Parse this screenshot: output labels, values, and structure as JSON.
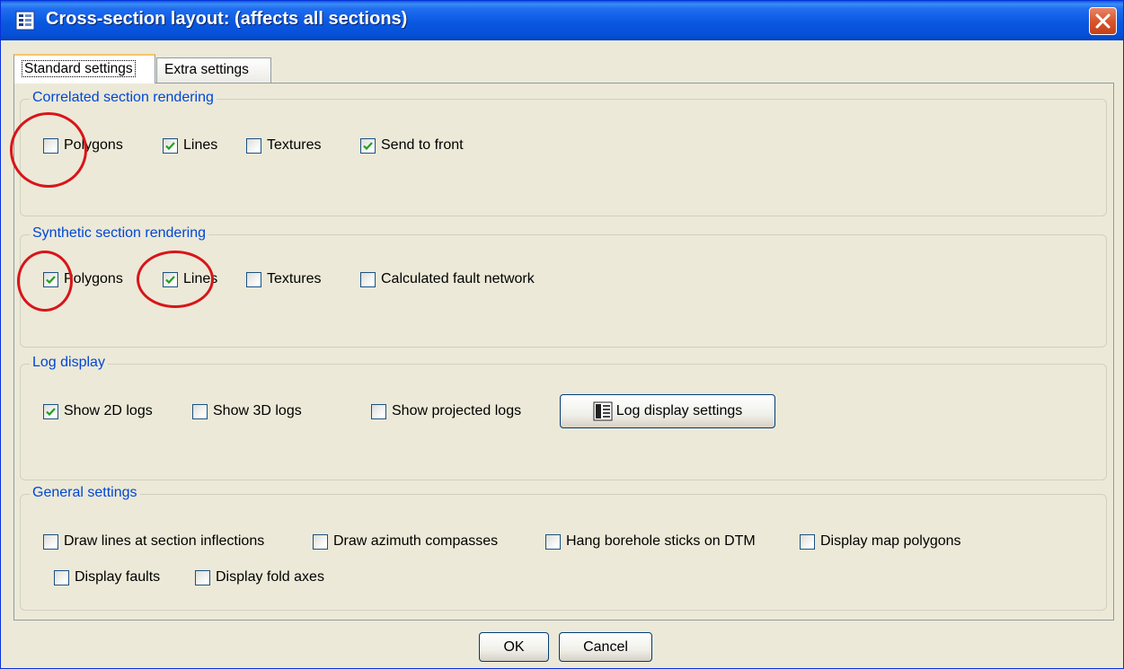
{
  "window": {
    "title": "Cross-section layout: (affects all sections)",
    "icon": "dialog-list-icon",
    "close_icon": "close-icon"
  },
  "tabs": [
    {
      "label": "Standard settings",
      "active": true
    },
    {
      "label": "Extra settings",
      "active": false
    }
  ],
  "correlated": {
    "legend": "Correlated section rendering",
    "options": [
      {
        "label": "Polygons",
        "checked": false
      },
      {
        "label": "Lines",
        "checked": true
      },
      {
        "label": "Textures",
        "checked": false
      },
      {
        "label": "Send to front",
        "checked": true
      }
    ]
  },
  "synthetic": {
    "legend": "Synthetic section rendering",
    "options": [
      {
        "label": "Polygons",
        "checked": true
      },
      {
        "label": "Lines",
        "checked": true
      },
      {
        "label": "Textures",
        "checked": false
      },
      {
        "label": "Calculated fault network",
        "checked": false
      }
    ]
  },
  "log_display": {
    "legend": "Log display",
    "options": [
      {
        "label": "Show 2D logs",
        "checked": true
      },
      {
        "label": "Show 3D logs",
        "checked": false
      },
      {
        "label": "Show projected logs",
        "checked": false
      }
    ],
    "settings_button": "Log display settings"
  },
  "general": {
    "legend": "General settings",
    "options": [
      {
        "label": "Draw lines at section inflections",
        "checked": false
      },
      {
        "label": "Draw azimuth compasses",
        "checked": false
      },
      {
        "label": "Hang borehole sticks on DTM",
        "checked": false
      },
      {
        "label": "Display map polygons",
        "checked": false
      },
      {
        "label": "Display faults",
        "checked": false
      },
      {
        "label": "Display fold axes",
        "checked": false
      }
    ]
  },
  "footer": {
    "ok": "OK",
    "cancel": "Cancel"
  },
  "colors": {
    "title_bar": "#0a58e0",
    "legend_text": "#0046d5",
    "annotation": "#d8151a",
    "background": "#ece9d8"
  }
}
